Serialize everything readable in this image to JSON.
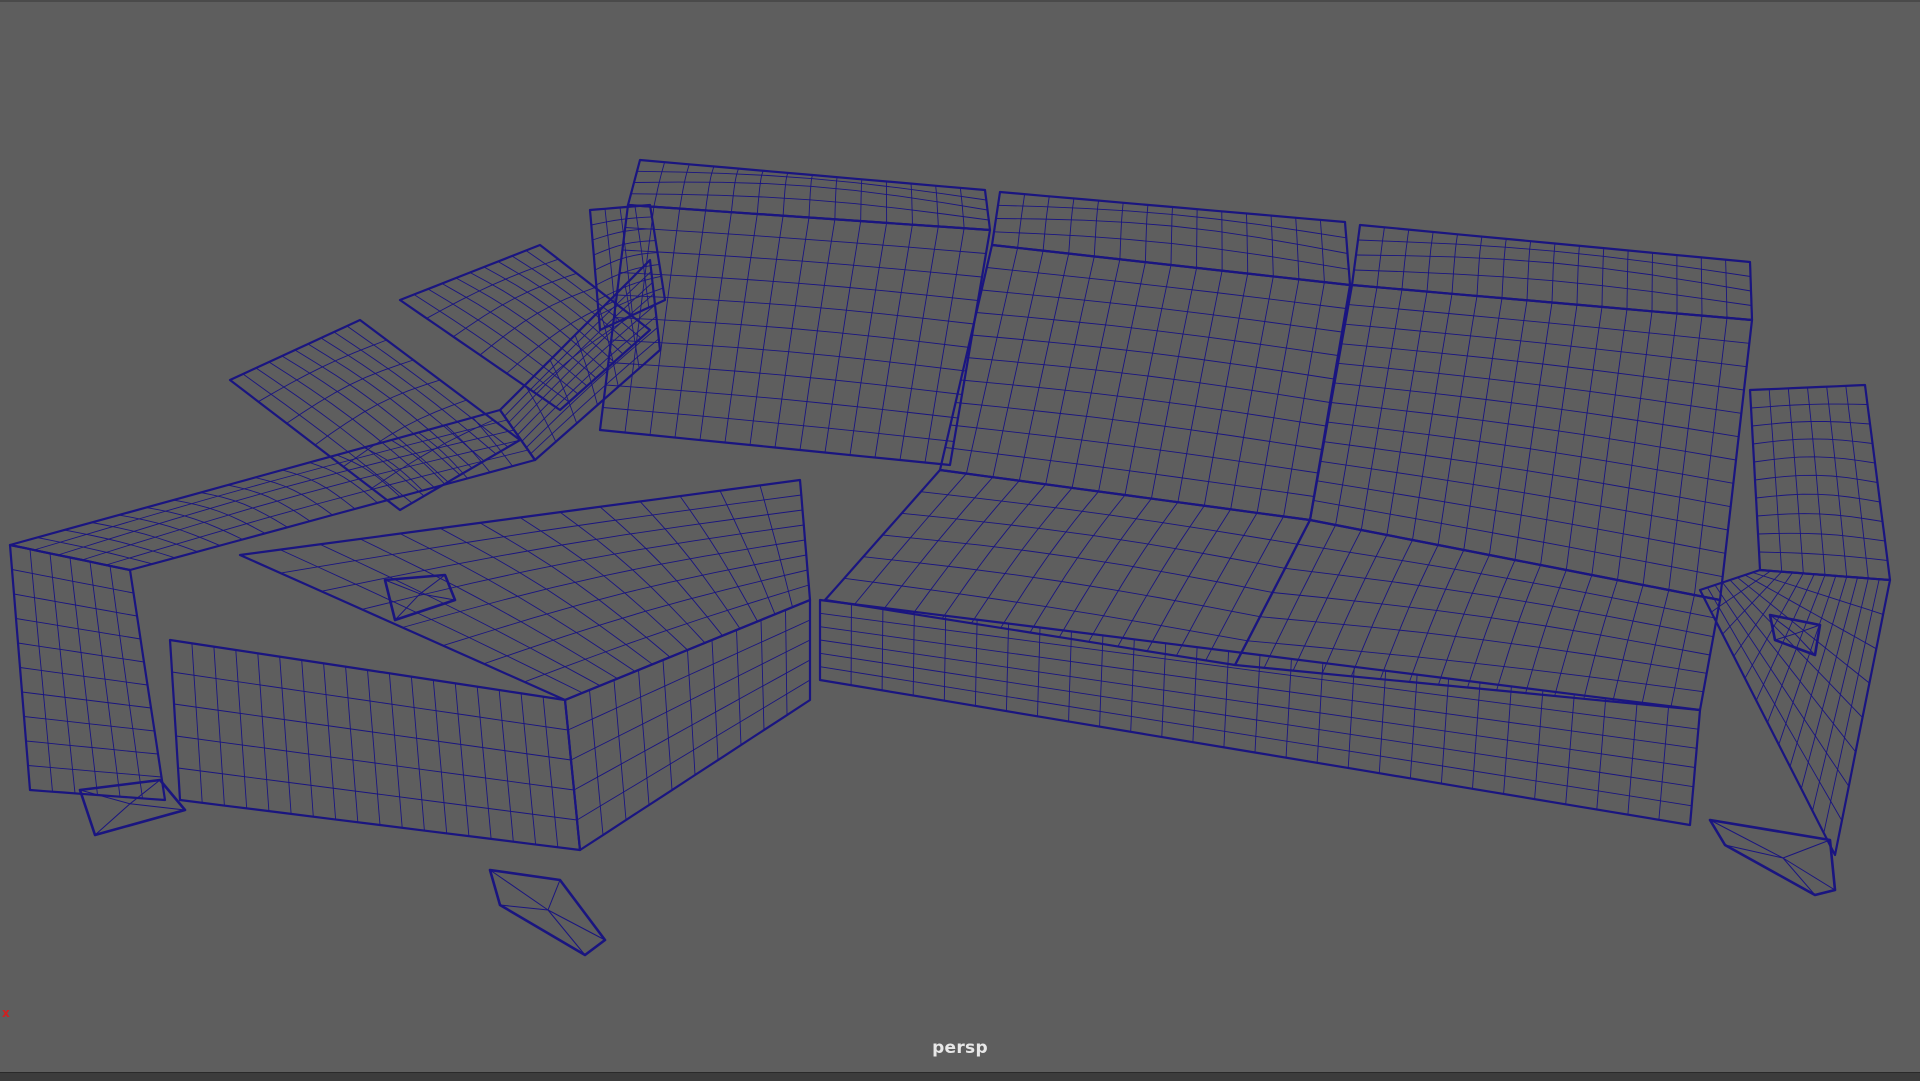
{
  "viewport": {
    "camera_name": "persp",
    "display_mode": "wireframe",
    "background_color": "#5e5e5e",
    "wire_color": "#1a1580"
  },
  "axis_gizmo": {
    "x_label": "x",
    "x_color": "#d02020"
  },
  "scene": {
    "object": "sectional-sofa-wireframe"
  }
}
